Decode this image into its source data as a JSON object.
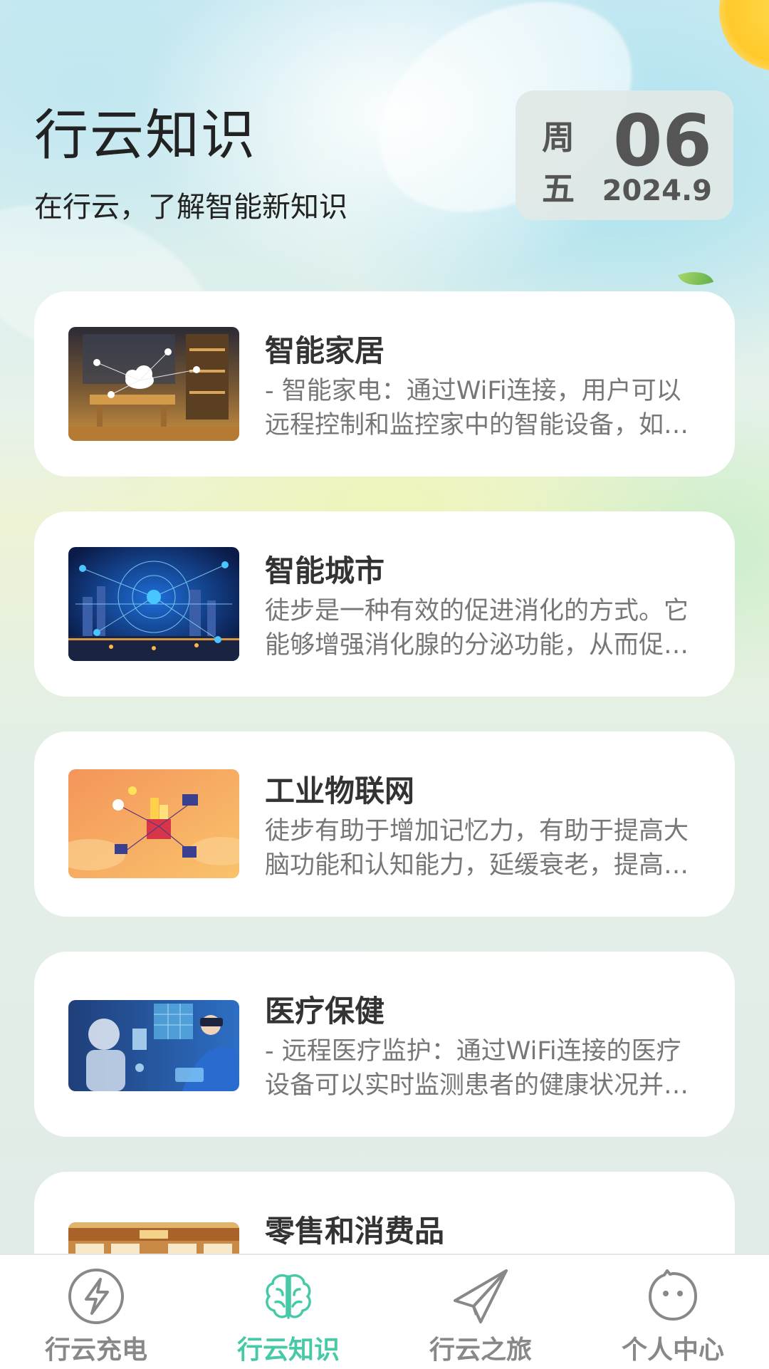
{
  "header": {
    "title": "行云知识",
    "subtitle": "在行云，了解智能新知识"
  },
  "date": {
    "weekday_1": "周",
    "weekday_2": "五",
    "day": "06",
    "year_month": "2024.9"
  },
  "cards": [
    {
      "title": "智能家居",
      "desc": "- 智能家电：通过WiFi连接，用户可以远程控制和监控家中的智能设备，如智能灯泡、智能插座等。",
      "image": "smart-home-image"
    },
    {
      "title": "智能城市",
      "desc": "徒步是一种有效的促进消化的方式。它能够增强消化腺的分泌功能，从而促进食物的消化吸收。",
      "image": "smart-city-image"
    },
    {
      "title": "工业物联网",
      "desc": "徒步有助于增加记忆力，有助于提高大脑功能和认知能力，延缓衰老，提高生活质量。",
      "image": "industrial-iot-image"
    },
    {
      "title": "医疗保健",
      "desc": "- 远程医疗监护：通过WiFi连接的医疗设备可以实时监测患者的健康状况并传输数据。",
      "image": "healthcare-image"
    },
    {
      "title": "零售和消费品",
      "desc": "",
      "image": "retail-image"
    }
  ],
  "tabs": [
    {
      "label": "行云充电",
      "icon": "lightning-icon",
      "active": false
    },
    {
      "label": "行云知识",
      "icon": "brain-icon",
      "active": true
    },
    {
      "label": "行云之旅",
      "icon": "paper-plane-icon",
      "active": false
    },
    {
      "label": "个人中心",
      "icon": "smiley-face-icon",
      "active": false
    }
  ],
  "colors": {
    "accent": "#46c9a6",
    "inactive": "#888888",
    "title_text": "#222222",
    "desc_text": "#777777"
  }
}
